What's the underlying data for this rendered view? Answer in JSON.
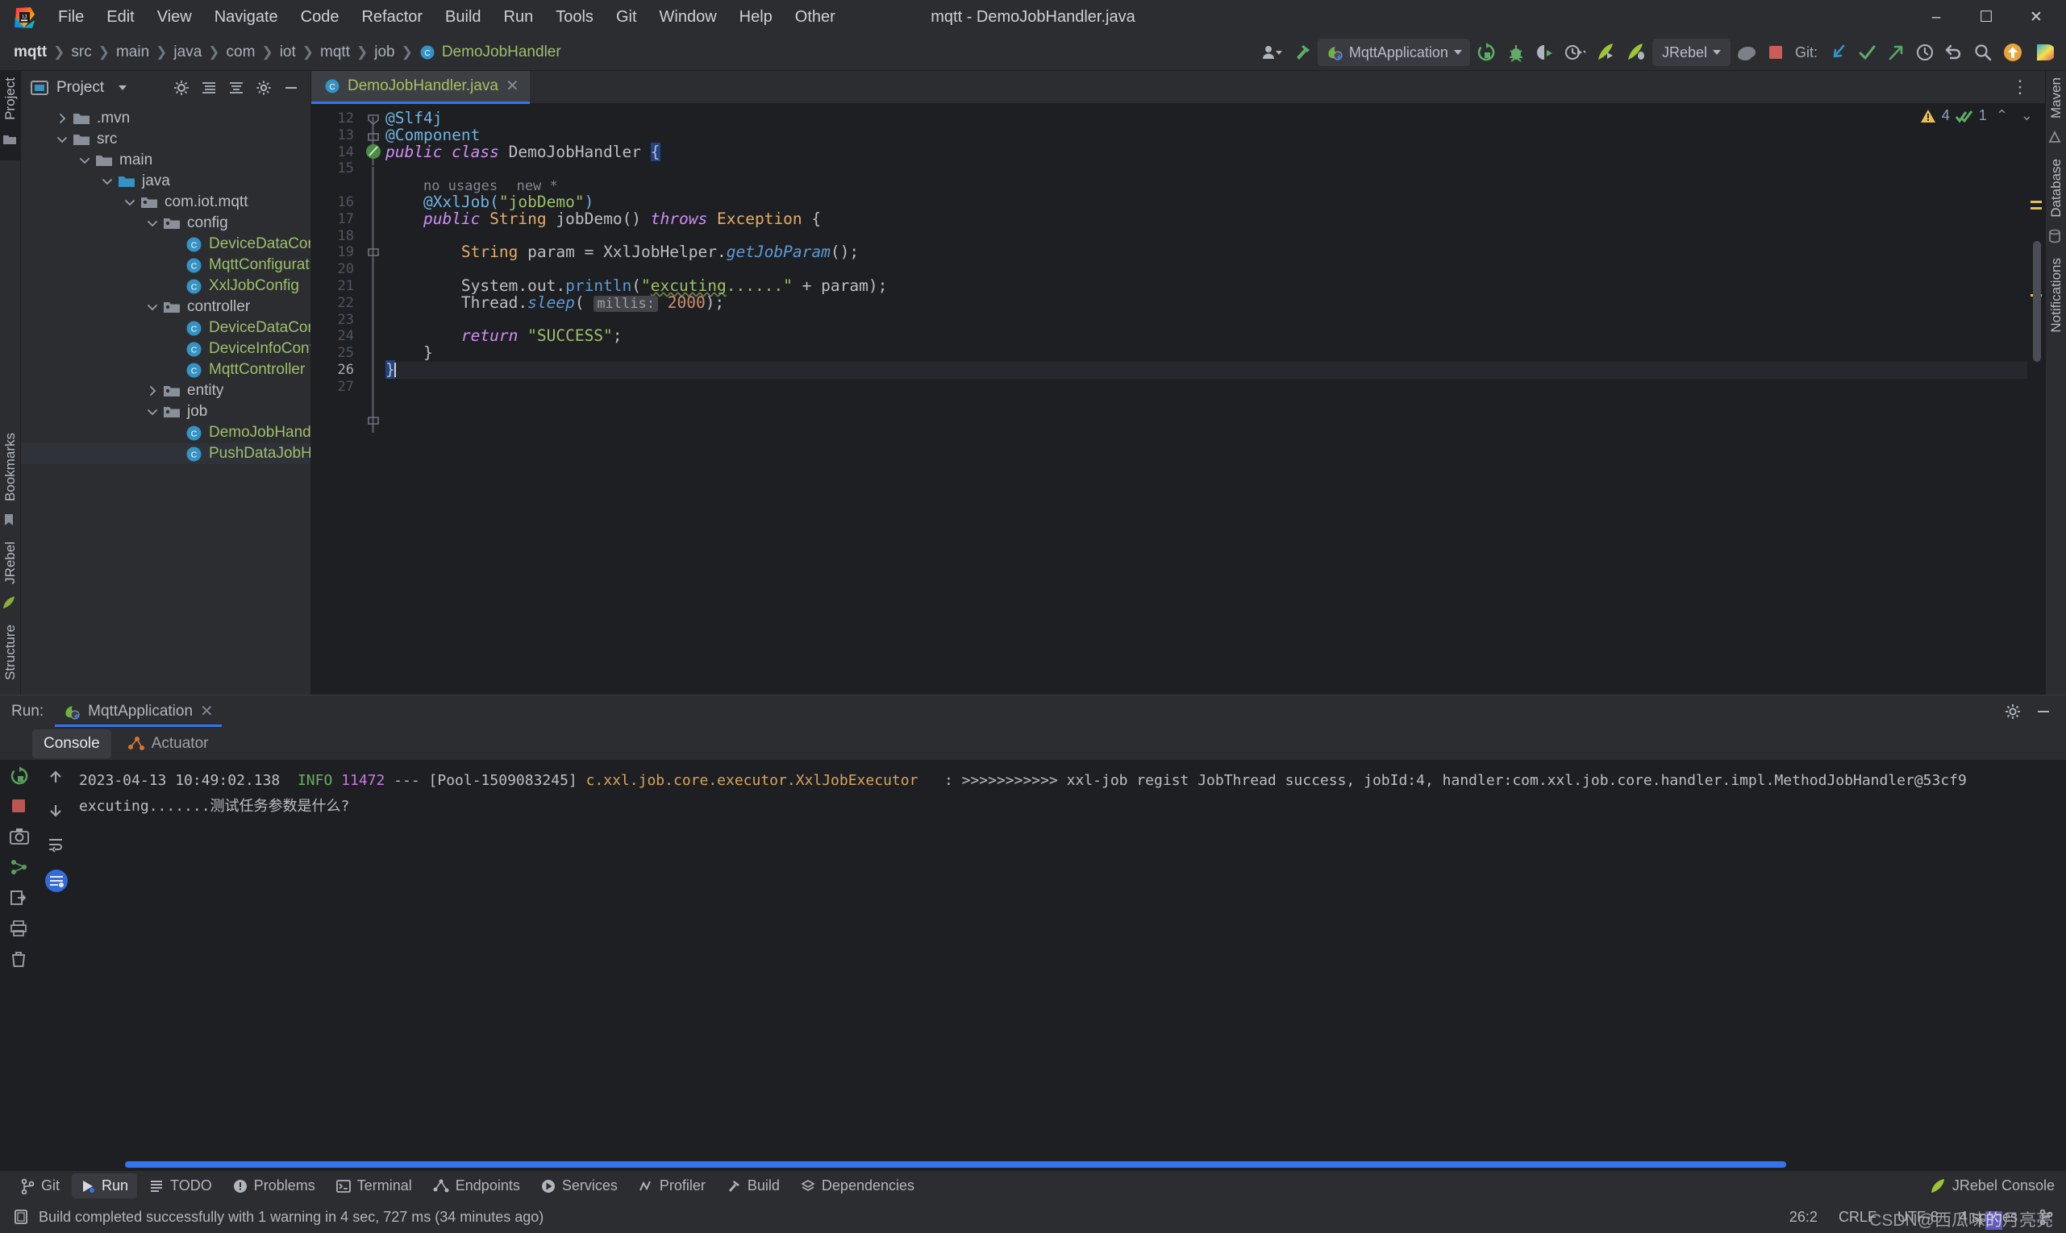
{
  "window": {
    "title": "mqtt - DemoJobHandler.java"
  },
  "menu": {
    "items": [
      "File",
      "Edit",
      "View",
      "Navigate",
      "Code",
      "Refactor",
      "Build",
      "Run",
      "Tools",
      "Git",
      "Window",
      "Help",
      "Other"
    ]
  },
  "window_controls": {
    "minimize": "–",
    "maximize": "☐",
    "close": "✕"
  },
  "breadcrumbs": [
    {
      "label": "mqtt",
      "style": "bold"
    },
    {
      "label": "src",
      "style": "normal"
    },
    {
      "label": "main",
      "style": "normal"
    },
    {
      "label": "java",
      "style": "normal"
    },
    {
      "label": "com",
      "style": "normal"
    },
    {
      "label": "iot",
      "style": "normal"
    },
    {
      "label": "mqtt",
      "style": "normal"
    },
    {
      "label": "job",
      "style": "normal"
    },
    {
      "label": "DemoJobHandler",
      "style": "class"
    }
  ],
  "toolbar": {
    "run_config": "MqttApplication",
    "jrebel_config": "JRebel",
    "git_label": "Git:",
    "icons": [
      "user-avatar-icon",
      "build-hammer-icon",
      "rerun-icon",
      "debug-icon",
      "run-with-coverage-icon",
      "profiler-icon",
      "jrebel-run-icon",
      "jrebel-debug-icon",
      "gradle-elephant-icon",
      "stop-icon",
      "git-update-icon",
      "git-commit-icon",
      "git-push-icon",
      "git-history-icon",
      "git-rollback-icon",
      "search-everywhere-icon",
      "notifications-icon",
      "ide-feature-icon"
    ]
  },
  "left_strip": {
    "project_label": "Project",
    "bookmarks_label": "Bookmarks",
    "jrebel_label": "JRebel",
    "structure_label": "Structure"
  },
  "right_strip": {
    "maven_label": "Maven",
    "database_label": "Database",
    "notifications_label": "Notifications"
  },
  "project": {
    "panel_title": "Project",
    "tree": [
      {
        "label": ".mvn",
        "depth": 1,
        "type": "folder",
        "state": "collapsed",
        "selected": false
      },
      {
        "label": "src",
        "depth": 1,
        "type": "folder",
        "state": "expanded",
        "selected": false
      },
      {
        "label": "main",
        "depth": 2,
        "type": "folder",
        "state": "expanded",
        "selected": false
      },
      {
        "label": "java",
        "depth": 3,
        "type": "source-folder",
        "state": "expanded",
        "selected": false
      },
      {
        "label": "com.iot.mqtt",
        "depth": 4,
        "type": "package",
        "state": "expanded",
        "selected": false
      },
      {
        "label": "config",
        "depth": 5,
        "type": "package",
        "state": "expanded",
        "selected": false
      },
      {
        "label": "DeviceDataConfig",
        "depth": 6,
        "type": "class",
        "state": "leaf",
        "selected": false
      },
      {
        "label": "MqttConfiguration",
        "depth": 6,
        "type": "class",
        "state": "leaf",
        "selected": false
      },
      {
        "label": "XxlJobConfig",
        "depth": 6,
        "type": "class",
        "state": "leaf",
        "selected": false
      },
      {
        "label": "controller",
        "depth": 5,
        "type": "package",
        "state": "expanded",
        "selected": false
      },
      {
        "label": "DeviceDataController",
        "depth": 6,
        "type": "class",
        "state": "leaf",
        "selected": false
      },
      {
        "label": "DeviceInfoController",
        "depth": 6,
        "type": "class",
        "state": "leaf",
        "selected": false
      },
      {
        "label": "MqttController",
        "depth": 6,
        "type": "class",
        "state": "leaf",
        "selected": false
      },
      {
        "label": "entity",
        "depth": 5,
        "type": "package",
        "state": "collapsed",
        "selected": false
      },
      {
        "label": "job",
        "depth": 5,
        "type": "package",
        "state": "expanded",
        "selected": false
      },
      {
        "label": "DemoJobHandler",
        "depth": 6,
        "type": "class",
        "state": "leaf",
        "selected": false
      },
      {
        "label": "PushDataJobHandler",
        "depth": 6,
        "type": "class",
        "state": "leaf",
        "selected": true
      }
    ]
  },
  "editor": {
    "tab": {
      "label": "DemoJobHandler.java",
      "close": "✕"
    },
    "overflow": "⋮",
    "inspection": {
      "warnings": "4",
      "checks": "1",
      "up": "⌃",
      "down": "⌄"
    },
    "caret_line": 26,
    "lines": [
      {
        "n": "12",
        "text": "@Slf4j"
      },
      {
        "n": "13",
        "text": "@Component"
      },
      {
        "n": "14",
        "text": "public class DemoJobHandler {"
      },
      {
        "n": "15",
        "text": ""
      },
      {
        "n": "",
        "text": "no usages   new *"
      },
      {
        "n": "16",
        "text": "@XxlJob(\"jobDemo\")"
      },
      {
        "n": "17",
        "text": "public String jobDemo() throws Exception {"
      },
      {
        "n": "18",
        "text": ""
      },
      {
        "n": "19",
        "text": "String param = XxlJobHelper.getJobParam();"
      },
      {
        "n": "20",
        "text": ""
      },
      {
        "n": "21",
        "text": "System.out.println(\"excuting......\" + param);"
      },
      {
        "n": "22",
        "text": "Thread.sleep( millis: 2000);"
      },
      {
        "n": "23",
        "text": ""
      },
      {
        "n": "24",
        "text": "return \"SUCCESS\";"
      },
      {
        "n": "25",
        "text": "}"
      },
      {
        "n": "26",
        "text": "}"
      },
      {
        "n": "27",
        "text": ""
      }
    ]
  },
  "run_panel": {
    "label": "Run:",
    "config_name": "MqttApplication",
    "close": "✕",
    "sub_tabs": [
      {
        "label": "Console",
        "active": true,
        "icon": "console-icon"
      },
      {
        "label": "Actuator",
        "active": false,
        "icon": "actuator-icon"
      }
    ],
    "console": {
      "line1": {
        "timestamp": "2023-04-13 10:49:02.138",
        "level": "INFO",
        "pid": "11472",
        "sep": "---",
        "thread": "[Pool-1509083245]",
        "logger": "c.xxl.job.core.executor.XxlJobExecutor",
        "message": ": >>>>>>>>>>> xxl-job regist JobThread success, jobId:4, handler:com.xxl.job.core.handler.impl.MethodJobHandler@53cf9"
      },
      "line2": "excuting.......测试任务参数是什么?"
    }
  },
  "tool_windows": {
    "items": [
      {
        "label": "Git",
        "icon": "git-branch-icon",
        "active": false
      },
      {
        "label": "Run",
        "icon": "run-icon",
        "active": true
      },
      {
        "label": "TODO",
        "icon": "todo-icon",
        "active": false
      },
      {
        "label": "Problems",
        "icon": "problems-icon",
        "active": false
      },
      {
        "label": "Terminal",
        "icon": "terminal-icon",
        "active": false
      },
      {
        "label": "Endpoints",
        "icon": "endpoints-icon",
        "active": false
      },
      {
        "label": "Services",
        "icon": "services-icon",
        "active": false
      },
      {
        "label": "Profiler",
        "icon": "profiler-icon",
        "active": false
      },
      {
        "label": "Build",
        "icon": "build-icon",
        "active": false
      },
      {
        "label": "Dependencies",
        "icon": "dependencies-icon",
        "active": false
      }
    ],
    "right": {
      "label": "JRebel Console",
      "icon": "jrebel-icon"
    }
  },
  "status_bar": {
    "message": "Build completed successfully with 1 warning in 4 sec, 727 ms (34 minutes ago)",
    "caret_position": "26:2",
    "line_separator": "CRLF",
    "encoding": "UTF-8",
    "indent": "4 spaces",
    "branch_icon": "git-branch-icon",
    "watermark": "CSDN @西瓜味的月亮亮",
    "watermark_highlight": "的"
  },
  "colors": {
    "accent_blue": "#3574f0",
    "class_green": "#9fbf6a",
    "annotation_blue": "#6fb3e0",
    "keyword_purple": "#cf8ef5",
    "type_orange": "#e2ad68",
    "number_orange": "#cf8e6d",
    "bg_editor": "#1e1f22",
    "bg_panel": "#2b2d30",
    "warning_yellow": "#e8bf52",
    "info_green": "#6aaf5e"
  }
}
